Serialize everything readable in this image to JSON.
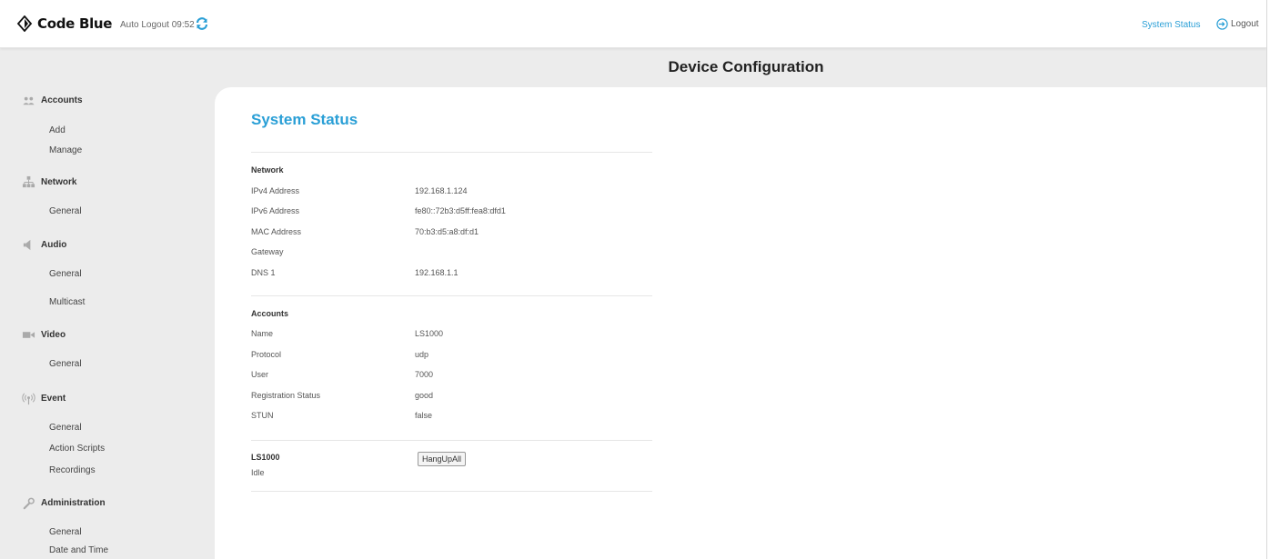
{
  "header": {
    "brand": "Code Blue",
    "auto_logout_label": "Auto Logout",
    "auto_logout_time": "09:52",
    "nav_system_status": "System Status",
    "nav_logout": "Logout"
  },
  "page_title": "Device Configuration",
  "sidebar": {
    "accounts": {
      "label": "Accounts",
      "items": [
        "Add",
        "Manage"
      ]
    },
    "network": {
      "label": "Network",
      "items": [
        "General"
      ]
    },
    "audio": {
      "label": "Audio",
      "items": [
        "General",
        "Multicast"
      ]
    },
    "video": {
      "label": "Video",
      "items": [
        "General"
      ]
    },
    "event": {
      "label": "Event",
      "items": [
        "General",
        "Action Scripts",
        "Recordings"
      ]
    },
    "administration": {
      "label": "Administration",
      "items": [
        "General",
        "Date and Time"
      ]
    }
  },
  "status": {
    "title": "System Status",
    "network": {
      "heading": "Network",
      "rows": [
        {
          "label": "IPv4 Address",
          "value": "192.168.1.124"
        },
        {
          "label": "IPv6 Address",
          "value": "fe80::72b3:d5ff:fea8:dfd1"
        },
        {
          "label": "MAC Address",
          "value": "70:b3:d5:a8:df:d1"
        },
        {
          "label": "Gateway",
          "value": ""
        },
        {
          "label": "DNS 1",
          "value": "192.168.1.1"
        }
      ]
    },
    "accounts": {
      "heading": "Accounts",
      "rows": [
        {
          "label": "Name",
          "value": "LS1000"
        },
        {
          "label": "Protocol",
          "value": "udp"
        },
        {
          "label": "User",
          "value": "7000"
        },
        {
          "label": "Registration Status",
          "value": "good"
        },
        {
          "label": "STUN",
          "value": "false"
        }
      ]
    },
    "line": {
      "name": "LS1000",
      "state": "Idle",
      "button": "HangUpAll"
    }
  },
  "colors": {
    "accent": "#2a9fd6",
    "band": "#ececec"
  }
}
